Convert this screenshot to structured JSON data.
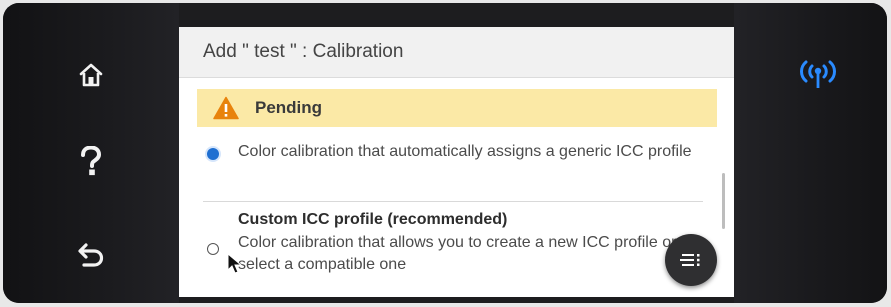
{
  "header": {
    "title": "Add \" test \" : Calibration"
  },
  "status": {
    "label": "Pending",
    "icon": "warning-icon",
    "color": "#fbe9a6"
  },
  "options": [
    {
      "selected": true,
      "title": "",
      "description": "Color calibration that automatically assigns a generic ICC profile"
    },
    {
      "selected": false,
      "title": "Custom ICC profile (recommended)",
      "description": "Color calibration that allows you to create a new ICC profile or select a compatible one"
    }
  ],
  "nav": {
    "home_icon": "home-icon",
    "help_icon": "help-icon",
    "back_icon": "back-icon"
  },
  "indicators": {
    "wireless_icon": "wireless-icon",
    "wireless_color": "#2a8bff"
  },
  "fab": {
    "icon": "menu-list-icon"
  },
  "colors": {
    "accent": "#1f6fd1",
    "bezel": "#1d1d1f"
  }
}
